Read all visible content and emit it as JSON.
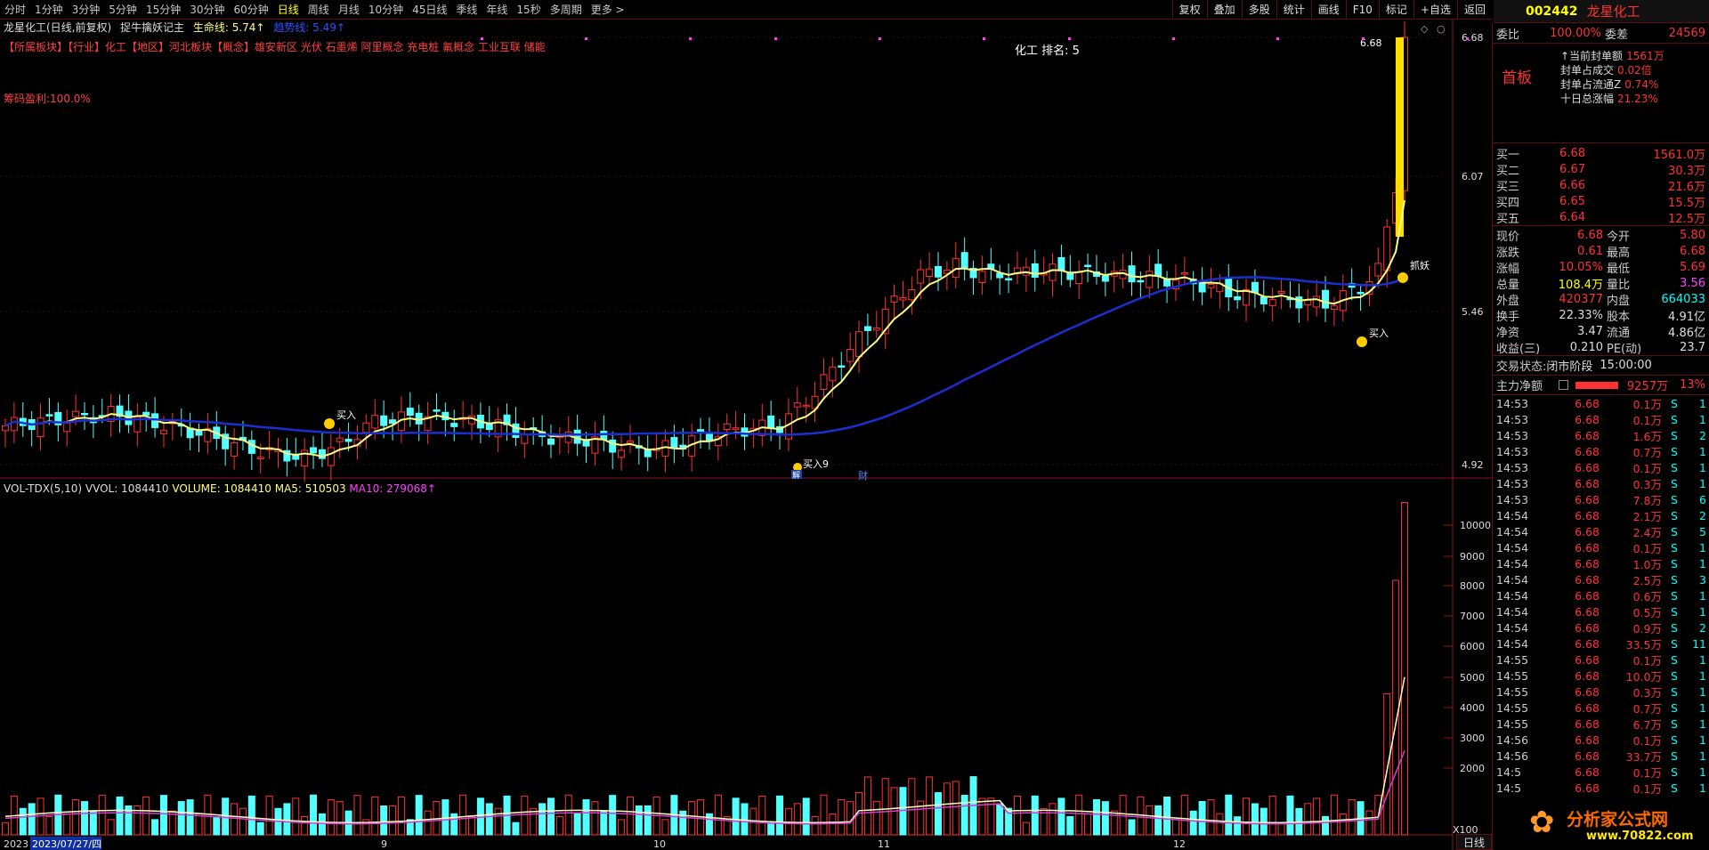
{
  "periods": [
    "分时",
    "1分钟",
    "3分钟",
    "5分钟",
    "15分钟",
    "30分钟",
    "60分钟",
    "日线",
    "周线",
    "月线",
    "10分钟",
    "45日线",
    "季线",
    "年线",
    "15秒",
    "多周期",
    "更多 >"
  ],
  "active_period": "日线",
  "tools": [
    "复权",
    "叠加",
    "多股",
    "统计",
    "画线",
    "F10",
    "标记",
    "+自选",
    "返回"
  ],
  "stock": {
    "code": "002442",
    "name": "龙星化工"
  },
  "info": {
    "title": "龙星化工(日线,前复权)",
    "indicator": "捉牛擒妖记主",
    "life_line": "生命线: 5.74↑",
    "trend_line": "趋势线: 5.49↑"
  },
  "concepts": "【所属板块】【行业】化工【地区】河北板块【概念】雄安新区 光伏 石墨烯 阿里概念 充电桩 氟概念 工业互联 储能",
  "profit": "筹码盈利:100.0%",
  "rank": "化工 排名: 5",
  "price_axis": [
    "6.68",
    "6.07",
    "5.46",
    "4.92"
  ],
  "vol_axis": [
    "10000",
    "9000",
    "8000",
    "7000",
    "6000",
    "5000",
    "4000",
    "3000",
    "2000"
  ],
  "vol_unit": "X100",
  "date_labels": [
    "2023",
    "2023/07/27/四",
    "9",
    "10",
    "11",
    "12"
  ],
  "signals": {
    "buy": "买入",
    "buy9": "买入9",
    "catch": "抓妖",
    "high_label": "6.68",
    "cai": "财",
    "jie": "解"
  },
  "vol_info": {
    "name": "VOL-TDX(5,10)",
    "vvol": "VVOL: 1084410",
    "volume": "VOLUME: 1084410",
    "ma5": "MA5: 510503",
    "ma10": "MA10: 279068↑"
  },
  "colors": {
    "up": "#ff3232",
    "down": "#54ffff",
    "ma_short": "#ffff80",
    "ma_long": "#1a2fd0",
    "vol_ma5": "#ffffc0",
    "vol_ma10": "#d040d0"
  },
  "panel": {
    "weibi_label": "委比",
    "weibi": "100.00%",
    "weicha_label": "委差",
    "weicha": "24569",
    "board": "首板",
    "seal_info": [
      {
        "label": "↑当前封单额",
        "value": "1561万"
      },
      {
        "label": "封单占成交",
        "value": "0.02倍"
      },
      {
        "label": "封单占流通Z",
        "value": "0.74%"
      },
      {
        "label": "十日总涨幅",
        "value": "21.23%"
      }
    ],
    "bids": [
      {
        "label": "买一",
        "price": "6.68",
        "vol": "1561.0万"
      },
      {
        "label": "买二",
        "price": "6.67",
        "vol": "30.3万"
      },
      {
        "label": "买三",
        "price": "6.66",
        "vol": "21.6万"
      },
      {
        "label": "买四",
        "price": "6.65",
        "vol": "15.5万"
      },
      {
        "label": "买五",
        "price": "6.64",
        "vol": "12.5万"
      }
    ],
    "stats": [
      {
        "l1": "现价",
        "v1": "6.68",
        "c1": "red",
        "l2": "今开",
        "v2": "5.80",
        "c2": "red"
      },
      {
        "l1": "涨跌",
        "v1": "0.61",
        "c1": "red",
        "l2": "最高",
        "v2": "6.68",
        "c2": "red"
      },
      {
        "l1": "涨幅",
        "v1": "10.05%",
        "c1": "red",
        "l2": "最低",
        "v2": "5.69",
        "c2": "red"
      },
      {
        "l1": "总量",
        "v1": "108.4万",
        "c1": "yellow",
        "l2": "量比",
        "v2": "3.56",
        "c2": "magenta"
      },
      {
        "l1": "外盘",
        "v1": "420377",
        "c1": "red",
        "l2": "内盘",
        "v2": "664033",
        "c2": "green"
      },
      {
        "l1": "换手",
        "v1": "22.33%",
        "c1": "white",
        "l2": "股本",
        "v2": "4.91亿",
        "c2": "white"
      },
      {
        "l1": "净资",
        "v1": "3.47",
        "c1": "white",
        "l2": "流通",
        "v2": "4.86亿",
        "c2": "white"
      },
      {
        "l1": "收益(三)",
        "v1": "0.210",
        "c1": "white",
        "l2": "PE(动)",
        "v2": "23.7",
        "c2": "white"
      }
    ],
    "status_label": "交易状态:",
    "status": "闭市阶段",
    "status_time": "15:00:00",
    "main_force_label": "主力净额",
    "main_force": "9257万",
    "main_force_pct": "13%",
    "trades": [
      [
        "14:53",
        "6.68",
        "0.1万",
        "S",
        "1"
      ],
      [
        "14:53",
        "6.68",
        "0.1万",
        "S",
        "1"
      ],
      [
        "14:53",
        "6.68",
        "1.6万",
        "S",
        "2"
      ],
      [
        "14:53",
        "6.68",
        "0.7万",
        "S",
        "1"
      ],
      [
        "14:53",
        "6.68",
        "0.1万",
        "S",
        "1"
      ],
      [
        "14:53",
        "6.68",
        "0.3万",
        "S",
        "1"
      ],
      [
        "14:53",
        "6.68",
        "7.8万",
        "S",
        "6"
      ],
      [
        "14:54",
        "6.68",
        "2.1万",
        "S",
        "2"
      ],
      [
        "14:54",
        "6.68",
        "2.4万",
        "S",
        "5"
      ],
      [
        "14:54",
        "6.68",
        "0.1万",
        "S",
        "1"
      ],
      [
        "14:54",
        "6.68",
        "1.0万",
        "S",
        "1"
      ],
      [
        "14:54",
        "6.68",
        "2.5万",
        "S",
        "3"
      ],
      [
        "14:54",
        "6.68",
        "0.6万",
        "S",
        "1"
      ],
      [
        "14:54",
        "6.68",
        "0.5万",
        "S",
        "1"
      ],
      [
        "14:54",
        "6.68",
        "0.9万",
        "S",
        "2"
      ],
      [
        "14:54",
        "6.68",
        "33.5万",
        "S",
        "11"
      ],
      [
        "14:55",
        "6.68",
        "0.1万",
        "S",
        "1"
      ],
      [
        "14:55",
        "6.68",
        "10.0万",
        "S",
        "1"
      ],
      [
        "14:55",
        "6.68",
        "0.3万",
        "S",
        "1"
      ],
      [
        "14:55",
        "6.68",
        "0.7万",
        "S",
        "1"
      ],
      [
        "14:55",
        "6.68",
        "6.7万",
        "S",
        "1"
      ],
      [
        "14:56",
        "6.68",
        "0.1万",
        "S",
        "1"
      ],
      [
        "14:56",
        "6.68",
        "33.7万",
        "S",
        "1"
      ],
      [
        "14:5",
        "6.68",
        "0.1万",
        "S",
        "1"
      ],
      [
        "14:5",
        "6.68",
        "0.1万",
        "S",
        "1"
      ]
    ]
  },
  "watermark": {
    "brand": "分析家公式网",
    "url": "www.70822.com"
  },
  "bottom_tab": "日线"
}
